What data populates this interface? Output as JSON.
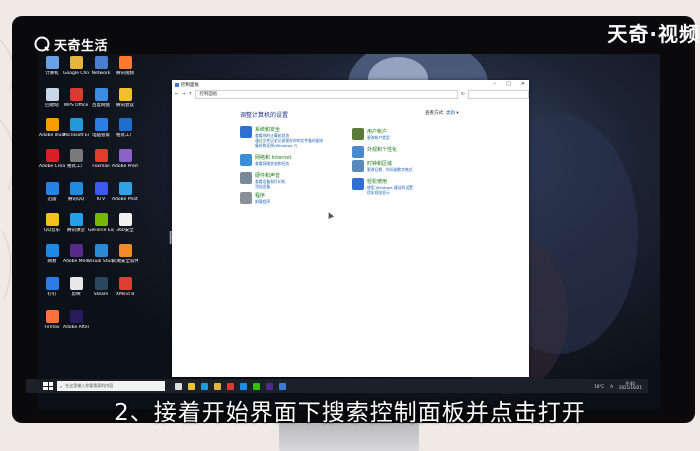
{
  "watermark": {
    "left": "天奇生活",
    "right": "天奇·视频"
  },
  "subtitle": "2、接着开始界面下搜索控制面板并点击打开",
  "desktop_icons": [
    {
      "label": "计算机",
      "color": "#6aa0e6"
    },
    {
      "label": "Google Chrome",
      "color": "#e4b53a"
    },
    {
      "label": "Network",
      "color": "#4a7ed0"
    },
    {
      "label": "腾讯视频",
      "color": "#ff7a2e"
    },
    {
      "label": "回收站",
      "color": "#c9d6e8"
    },
    {
      "label": "WPS Office",
      "color": "#d83b2f"
    },
    {
      "label": "百度网盘",
      "color": "#3a8de0"
    },
    {
      "label": "腾讯会议",
      "color": "#f0c030"
    },
    {
      "label": "Adobe Illustrat...",
      "color": "#ff9a00"
    },
    {
      "label": "Microsoft Edge",
      "color": "#1f9ad8"
    },
    {
      "label": "电脑管家",
      "color": "#2b7de9"
    },
    {
      "label": "格式工厂",
      "color": "#1d6fc9"
    },
    {
      "label": "Adobe Creati...",
      "color": "#da1f26"
    },
    {
      "label": "格式工厂",
      "color": "#7a7a7a"
    },
    {
      "label": "Foxmail",
      "color": "#e23c2c"
    },
    {
      "label": "Adobe Premiere",
      "color": "#8a62c8"
    },
    {
      "label": "迅雷",
      "color": "#2583e8"
    },
    {
      "label": "腾讯QQ",
      "color": "#1d8ce0"
    },
    {
      "label": "KTV",
      "color": "#3d5af0"
    },
    {
      "label": "Adobe Photosh...",
      "color": "#2fa3e6"
    },
    {
      "label": "QQ音乐",
      "color": "#f2c11b"
    },
    {
      "label": "腾讯课堂",
      "color": "#22a0e8"
    },
    {
      "label": "GeForce Experience",
      "color": "#76b900"
    },
    {
      "label": "360安全",
      "color": "#f0f0f0"
    },
    {
      "label": "网易",
      "color": "#1e88e5"
    },
    {
      "label": "Adobe Media En...",
      "color": "#5a2a8a"
    },
    {
      "label": "Visual Studio Code",
      "color": "#2a8ad8"
    },
    {
      "label": "火绒安全软件",
      "color": "#f28c28"
    },
    {
      "label": "钉钉",
      "color": "#2c7be5"
    },
    {
      "label": "剪映",
      "color": "#e8e8e8"
    },
    {
      "label": "Steam",
      "color": "#2a475e"
    },
    {
      "label": "XMind 8",
      "color": "#e03c31"
    },
    {
      "label": "Firefox",
      "color": "#ff7139"
    },
    {
      "label": "Adobe After Effects",
      "color": "#2a1a5e"
    }
  ],
  "control_panel": {
    "window_title": "控制面板",
    "address": "控制面板",
    "heading": "调整计算机的设置",
    "view_by_label": "查看方式:",
    "view_by_value": "类别",
    "categories_left": [
      {
        "title": "系统和安全",
        "subs": [
          "查看你的计算机状态",
          "通过文件历史记录保存你的文件备份副本",
          "备份和还原(Windows 7)"
        ],
        "color": "#2d6fd4"
      },
      {
        "title": "网络和 Internet",
        "subs": [
          "查看网络状态和任务"
        ],
        "color": "#3a8fd8"
      },
      {
        "title": "硬件和声音",
        "subs": [
          "查看设备和打印机",
          "添加设备"
        ],
        "color": "#7a8a9a"
      },
      {
        "title": "程序",
        "subs": [
          "卸载程序"
        ],
        "color": "#8a9098"
      }
    ],
    "categories_right": [
      {
        "title": "用户帐户",
        "subs": [
          "更改帐户类型"
        ],
        "color": "#5a7a3a"
      },
      {
        "title": "外观和个性化",
        "subs": [],
        "color": "#4a8ad0"
      },
      {
        "title": "时钟和区域",
        "subs": [
          "更改日期、时间或数字格式"
        ],
        "color": "#5a8ab8"
      },
      {
        "title": "轻松使用",
        "subs": [
          "使用 Windows 建议的设置",
          "优化视觉显示"
        ],
        "color": "#2d6fd4"
      }
    ]
  },
  "taskbar": {
    "search_placeholder": "在这里输入你要搜索的内容",
    "tray": "A",
    "time": "9:40",
    "date": "2021/10/21",
    "weather": "18°C"
  }
}
